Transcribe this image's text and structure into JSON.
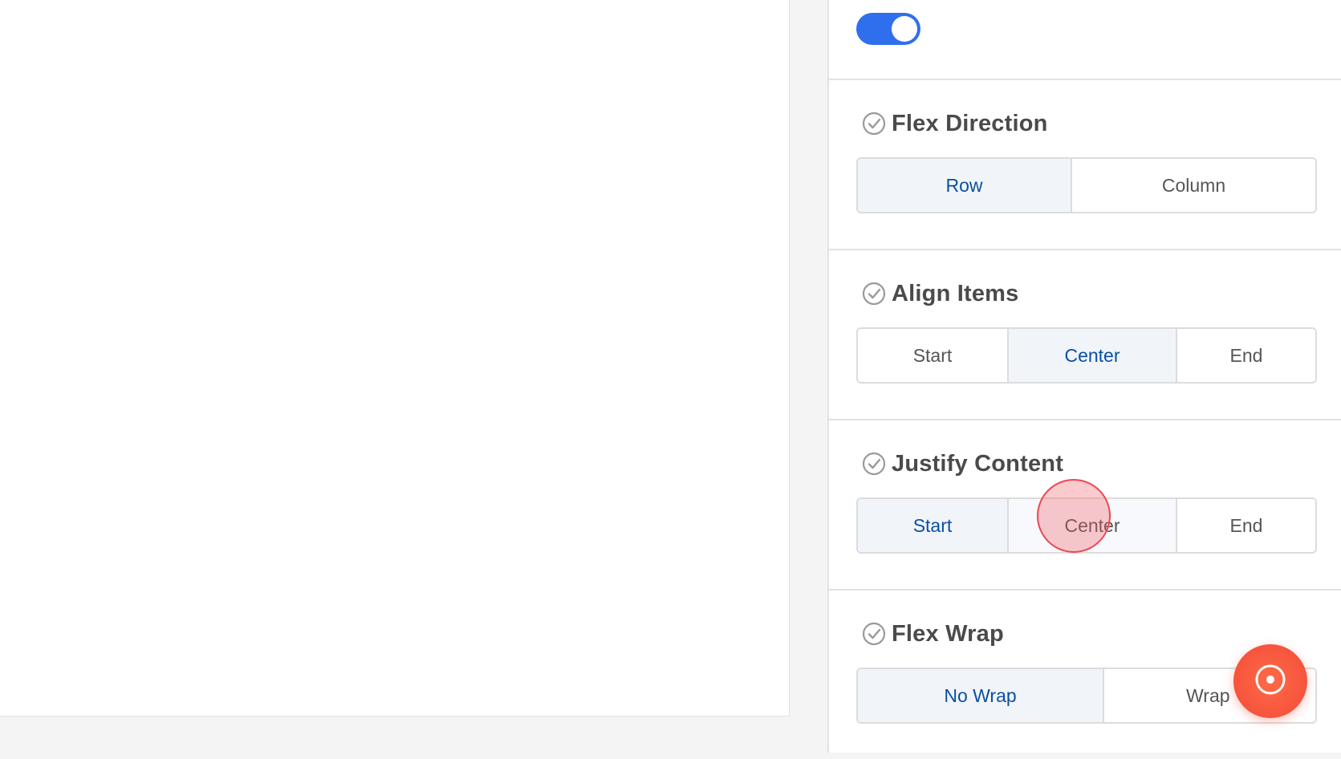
{
  "layout_toggle": {
    "enabled": true
  },
  "sections": [
    {
      "title": "Flex Direction",
      "options": [
        "Row",
        "Column"
      ],
      "selected": "Row"
    },
    {
      "title": "Align Items",
      "options": [
        "Start",
        "Center",
        "End"
      ],
      "selected": "Center"
    },
    {
      "title": "Justify Content",
      "options": [
        "Start",
        "Center",
        "End"
      ],
      "selected": "Start"
    },
    {
      "title": "Flex Wrap",
      "options": [
        "No Wrap",
        "Wrap"
      ],
      "selected": "No Wrap"
    }
  ],
  "colors": {
    "accent": "#2f6fee",
    "active_text": "#0b4fa0",
    "active_bg": "#f1f5fa",
    "fab": "#f6543d",
    "click_marker": "#ee4652"
  },
  "icons": {
    "section_check": "check-circle-icon",
    "fab": "target-icon"
  }
}
